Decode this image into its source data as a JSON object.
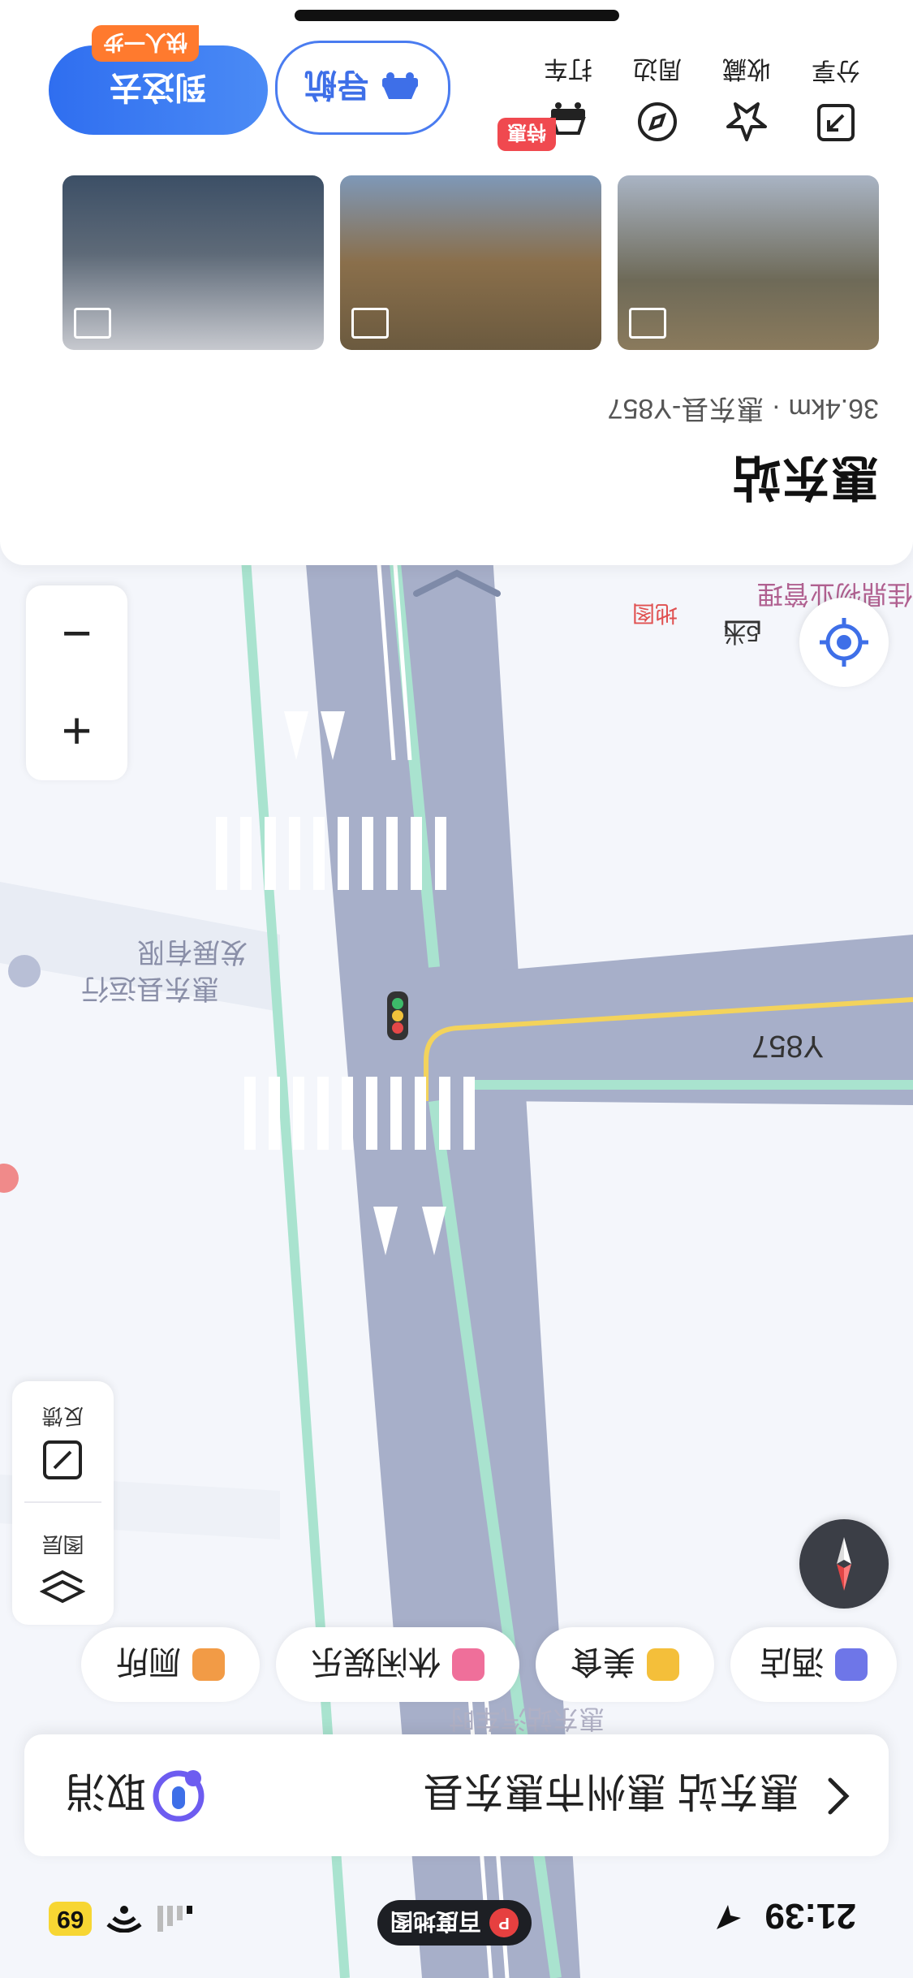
{
  "status_bar": {
    "time": "21:39",
    "battery": "69",
    "app_pill": "百度地图"
  },
  "search": {
    "query": "惠东站 惠州市惠东县",
    "cancel_label": "取消"
  },
  "categories": [
    {
      "label": "酒店",
      "icon": "hotel-icon"
    },
    {
      "label": "美食",
      "icon": "food-icon"
    },
    {
      "label": "休闲娱乐",
      "icon": "entertainment-icon"
    },
    {
      "label": "厕所",
      "icon": "toilet-icon"
    }
  ],
  "map_controls": {
    "layers_label": "图层",
    "feedback_label": "反馈",
    "zoom_in": "+",
    "zoom_out": "−"
  },
  "map_labels": {
    "road": "Y857",
    "company_line1": "惠东县运行",
    "company_line2": "发展有限",
    "scale": "5米",
    "bottom_poi": "惠东站汽车时",
    "top_poi_partial": "佳鼎物业管理",
    "watermark": "地图"
  },
  "poi": {
    "name": "惠东站",
    "distance": "36.4km",
    "address": "惠东县-Y857"
  },
  "actions": [
    {
      "label": "分享",
      "icon": "share-icon"
    },
    {
      "label": "收藏",
      "icon": "star-icon"
    },
    {
      "label": "周边",
      "icon": "compass-icon"
    },
    {
      "label": "打车",
      "icon": "taxi-icon",
      "badge": "特惠"
    }
  ],
  "nav_button": "导航",
  "go_button": "到这去",
  "go_badge": "快人一步",
  "colors": {
    "road": "#a7afc9",
    "lane_green": "#a9e3cf",
    "accent": "#3e6fe8",
    "badge_red": "#f0494f",
    "badge_orange": "#ff7a2e"
  }
}
